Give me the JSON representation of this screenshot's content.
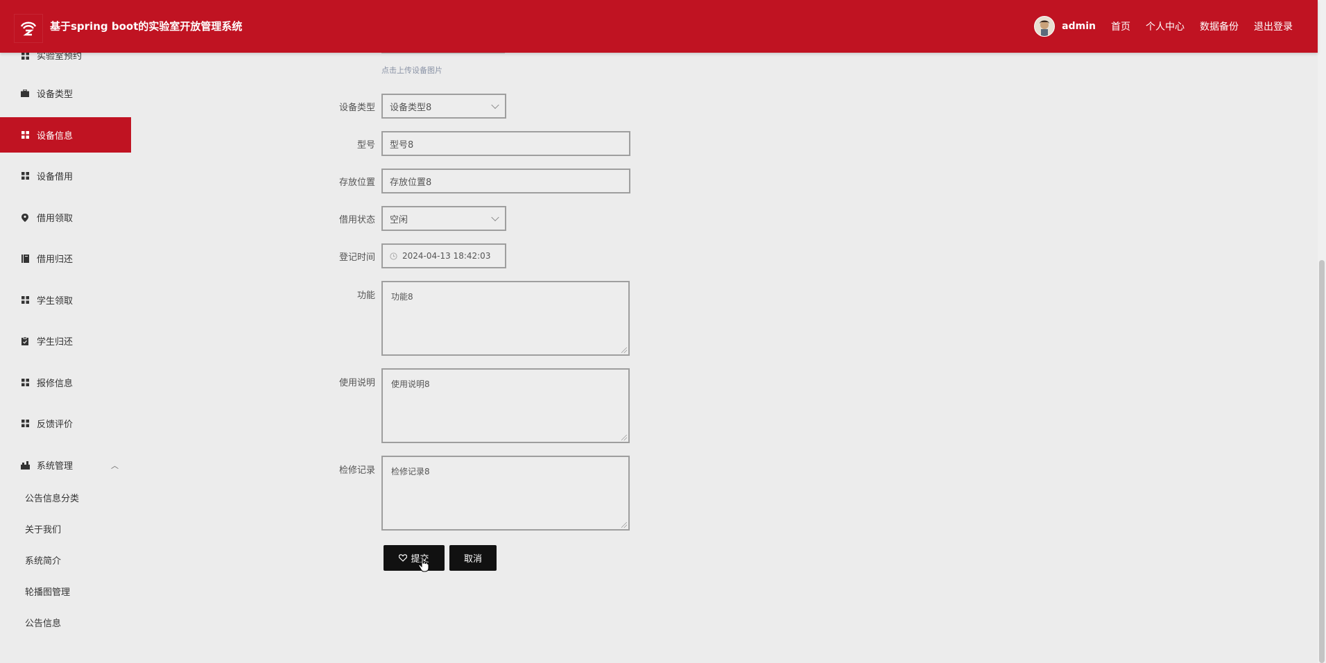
{
  "header": {
    "title": "基于spring boot的实验室开放管理系统",
    "username": "admin",
    "nav": [
      "首页",
      "个人中心",
      "数据备份",
      "退出登录"
    ],
    "brand_color": "#c01322"
  },
  "sidebar": {
    "items": [
      {
        "label": "实验室预约",
        "icon": "grid-icon"
      },
      {
        "label": "设备类型",
        "icon": "briefcase-icon"
      },
      {
        "label": "设备信息",
        "icon": "grid-icon",
        "active": true
      },
      {
        "label": "设备借用",
        "icon": "grid-icon"
      },
      {
        "label": "借用领取",
        "icon": "location-pin-icon"
      },
      {
        "label": "借用归还",
        "icon": "book-icon"
      },
      {
        "label": "学生领取",
        "icon": "grid-icon"
      },
      {
        "label": "学生归还",
        "icon": "clipboard-icon"
      },
      {
        "label": "报修信息",
        "icon": "grid-icon"
      },
      {
        "label": "反馈评价",
        "icon": "grid-icon"
      },
      {
        "label": "系统管理",
        "icon": "settings-icon",
        "expanded": true
      }
    ],
    "sub_items": [
      "公告信息分类",
      "关于我们",
      "系统简介",
      "轮播图管理",
      "公告信息"
    ]
  },
  "form": {
    "upload_hint": "点击上传设备图片",
    "device_type": {
      "label": "设备类型",
      "value": "设备类型8"
    },
    "model": {
      "label": "型号",
      "value": "型号8"
    },
    "location": {
      "label": "存放位置",
      "value": "存放位置8"
    },
    "borrow_status": {
      "label": "借用状态",
      "value": "空闲"
    },
    "register_time": {
      "label": "登记时间",
      "value": "2024-04-13 18:42:03"
    },
    "function": {
      "label": "功能",
      "value": "功能8"
    },
    "usage": {
      "label": "使用说明",
      "value": "使用说明8"
    },
    "maintenance": {
      "label": "检修记录",
      "value": "检修记录8"
    },
    "submit_label": "提交",
    "cancel_label": "取消"
  }
}
